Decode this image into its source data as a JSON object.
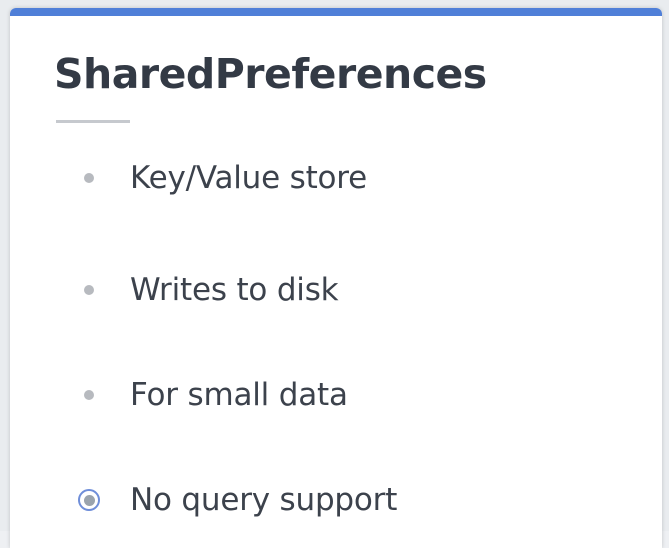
{
  "slide": {
    "title": "SharedPreferences",
    "accent_color": "#4f7fd8",
    "bullets": [
      {
        "label": "Key/Value store",
        "marker": "dot"
      },
      {
        "label": "Writes to disk",
        "marker": "dot"
      },
      {
        "label": "For small data",
        "marker": "dot"
      },
      {
        "label": "No query support",
        "marker": "radio-selected"
      }
    ]
  }
}
